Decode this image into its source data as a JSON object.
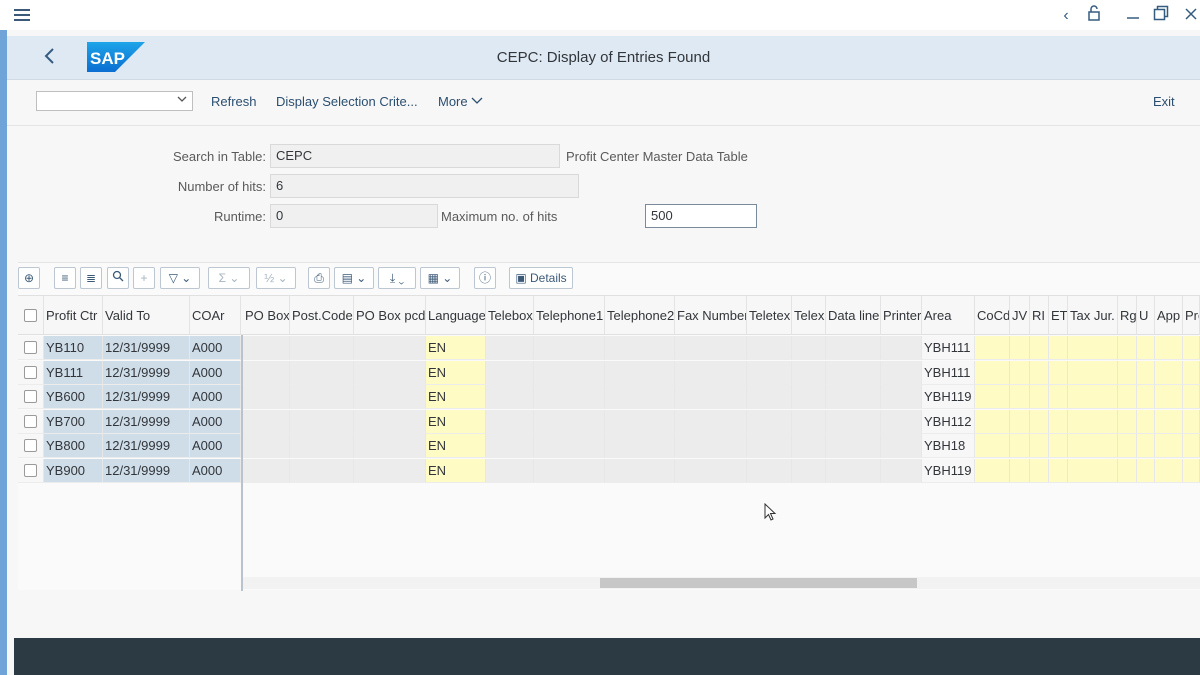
{
  "window": {
    "controls": [
      "chevron-left-icon",
      "unlock-icon",
      "minimize-icon",
      "restore-icon",
      "close-icon"
    ]
  },
  "header": {
    "title": "CEPC: Display of Entries Found",
    "logo_text": "SAP",
    "brand_color": "#0a6ed1"
  },
  "toolbar": {
    "select_value": "",
    "refresh": "Refresh",
    "display_selection": "Display Selection Crite...",
    "more": "More",
    "exit": "Exit"
  },
  "form": {
    "search_table_label": "Search in Table:",
    "search_table_value": "CEPC",
    "search_table_desc": "Profit Center Master Data Table",
    "hits_label": "Number of hits:",
    "hits_value": "6",
    "runtime_label": "Runtime:",
    "runtime_value": "0",
    "max_hits_label": "Maximum no. of hits",
    "max_hits_value": "500"
  },
  "grid": {
    "details_label": "Details",
    "columns": [
      "Profit Ctr",
      "Valid To",
      "COAr",
      "PO Box",
      "Post.Code",
      "PO Box pcd",
      "Language",
      "Telebox",
      "Telephone1",
      "Telephone2",
      "Fax Number",
      "Teletex",
      "Telex",
      "Data line",
      "Printer",
      "Area",
      "CoCd",
      "JV",
      "RI",
      "ET",
      "Tax Jur.",
      "Rg",
      "U",
      "App",
      "Pro"
    ],
    "rows": [
      {
        "profit_ctr": "YB110",
        "valid_to": "12/31/9999",
        "coar": "A000",
        "language": "EN",
        "area": "YBH111"
      },
      {
        "profit_ctr": "YB111",
        "valid_to": "12/31/9999",
        "coar": "A000",
        "language": "EN",
        "area": "YBH111"
      },
      {
        "profit_ctr": "YB600",
        "valid_to": "12/31/9999",
        "coar": "A000",
        "language": "EN",
        "area": "YBH119"
      },
      {
        "profit_ctr": "YB700",
        "valid_to": "12/31/9999",
        "coar": "A000",
        "language": "EN",
        "area": "YBH112"
      },
      {
        "profit_ctr": "YB800",
        "valid_to": "12/31/9999",
        "coar": "A000",
        "language": "EN",
        "area": "YBH18"
      },
      {
        "profit_ctr": "YB900",
        "valid_to": "12/31/9999",
        "coar": "A000",
        "language": "EN",
        "area": "YBH119"
      }
    ]
  }
}
